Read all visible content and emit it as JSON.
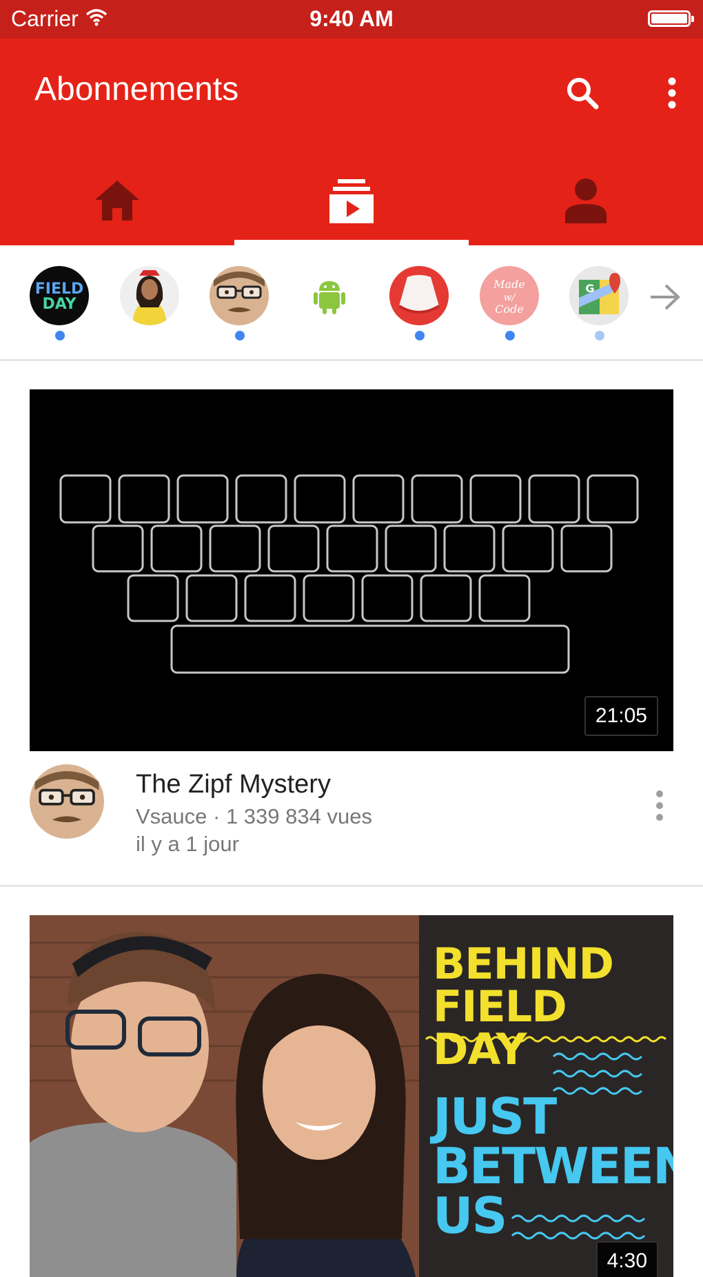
{
  "status_bar": {
    "carrier": "Carrier",
    "time": "9:40 AM",
    "wifi_icon": "wifi-icon",
    "battery_icon": "battery-icon"
  },
  "app_bar": {
    "title": "Abonnements",
    "search_icon": "search-icon",
    "more_icon": "more-vertical-icon",
    "tabs": [
      {
        "icon": "home-icon",
        "selected": false
      },
      {
        "icon": "subscriptions-icon",
        "selected": true
      },
      {
        "icon": "account-icon",
        "selected": false
      }
    ],
    "color": "#e52217",
    "status_color": "#c6201a"
  },
  "channel_strip": {
    "channels": [
      {
        "avatar": "field-day-avatar",
        "avatar_text": "FIELD DAY",
        "new": true
      },
      {
        "avatar": "woman-avatar",
        "avatar_text": "",
        "new": false
      },
      {
        "avatar": "vsauce-avatar",
        "avatar_text": "",
        "new": true
      },
      {
        "avatar": "android-avatar",
        "avatar_text": "",
        "new": false
      },
      {
        "avatar": "red-logo-avatar",
        "avatar_text": "",
        "new": true
      },
      {
        "avatar": "made-with-code-avatar",
        "avatar_text": "Made w/ Code",
        "new": true
      },
      {
        "avatar": "google-maps-avatar",
        "avatar_text": "G",
        "new": true,
        "dot_light": true
      }
    ],
    "arrow_icon": "arrow-right-icon"
  },
  "videos": [
    {
      "title": "The Zipf Mystery",
      "channel_views": "Vsauce · 1 339 834 vues",
      "age": "il y a 1 jour",
      "duration": "21:05",
      "thumbnail": "keyboard-thumbnail"
    },
    {
      "duration": "4:30",
      "thumbnail": "behind-field-day-thumbnail",
      "poster_lines_yellow": [
        "BEHIND",
        "FIELD DAY"
      ],
      "poster_lines_cyan": [
        "JUST",
        "BETWEEN",
        "US"
      ]
    }
  ]
}
